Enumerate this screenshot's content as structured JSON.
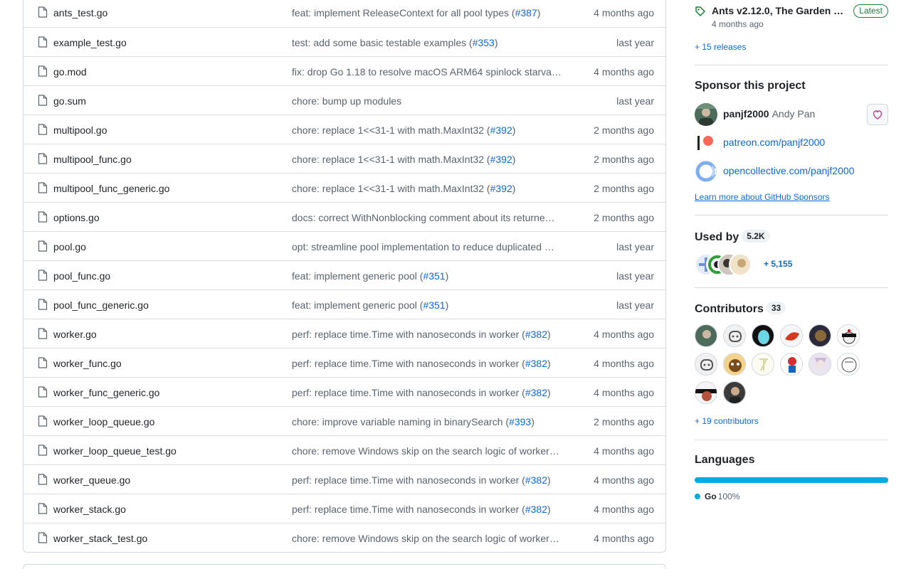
{
  "files": [
    {
      "name": "ants_test.go",
      "msg": "feat: implement ReleaseContext for all pool types (",
      "pr": "#387",
      "tail": ")",
      "age": "4 months ago"
    },
    {
      "name": "example_test.go",
      "msg": "test: add some basic testable examples (",
      "pr": "#353",
      "tail": ")",
      "age": "last year"
    },
    {
      "name": "go.mod",
      "msg": "fix: drop Go 1.18 to resolve macOS ARM64 spinlock starva…",
      "pr": "",
      "tail": "",
      "age": "4 months ago"
    },
    {
      "name": "go.sum",
      "msg": "chore: bump up modules",
      "pr": "",
      "tail": "",
      "age": "last year"
    },
    {
      "name": "multipool.go",
      "msg": "chore: replace 1<<31-1 with math.MaxInt32 (",
      "pr": "#392",
      "tail": ")",
      "age": "2 months ago"
    },
    {
      "name": "multipool_func.go",
      "msg": "chore: replace 1<<31-1 with math.MaxInt32 (",
      "pr": "#392",
      "tail": ")",
      "age": "2 months ago"
    },
    {
      "name": "multipool_func_generic.go",
      "msg": "chore: replace 1<<31-1 with math.MaxInt32 (",
      "pr": "#392",
      "tail": ")",
      "age": "2 months ago"
    },
    {
      "name": "options.go",
      "msg": "docs: correct WithNonblocking comment about its returne…",
      "pr": "",
      "tail": "",
      "age": "2 months ago"
    },
    {
      "name": "pool.go",
      "msg": "opt: streamline pool implementation to reduce duplicated …",
      "pr": "",
      "tail": "",
      "age": "last year"
    },
    {
      "name": "pool_func.go",
      "msg": "feat: implement generic pool (",
      "pr": "#351",
      "tail": ")",
      "age": "last year"
    },
    {
      "name": "pool_func_generic.go",
      "msg": "feat: implement generic pool (",
      "pr": "#351",
      "tail": ")",
      "age": "last year"
    },
    {
      "name": "worker.go",
      "msg": "perf: replace time.Time with nanoseconds in worker (",
      "pr": "#382",
      "tail": ")",
      "age": "4 months ago"
    },
    {
      "name": "worker_func.go",
      "msg": "perf: replace time.Time with nanoseconds in worker (",
      "pr": "#382",
      "tail": ")",
      "age": "4 months ago"
    },
    {
      "name": "worker_func_generic.go",
      "msg": "perf: replace time.Time with nanoseconds in worker (",
      "pr": "#382",
      "tail": ")",
      "age": "4 months ago"
    },
    {
      "name": "worker_loop_queue.go",
      "msg": "chore: improve variable naming in binarySearch (",
      "pr": "#393",
      "tail": ")",
      "age": "2 months ago"
    },
    {
      "name": "worker_loop_queue_test.go",
      "msg": "chore: remove Windows skip on the search logic of worker…",
      "pr": "",
      "tail": "",
      "age": "4 months ago"
    },
    {
      "name": "worker_queue.go",
      "msg": "perf: replace time.Time with nanoseconds in worker (",
      "pr": "#382",
      "tail": ")",
      "age": "4 months ago"
    },
    {
      "name": "worker_stack.go",
      "msg": "perf: replace time.Time with nanoseconds in worker (",
      "pr": "#382",
      "tail": ")",
      "age": "4 months ago"
    },
    {
      "name": "worker_stack_test.go",
      "msg": "chore: remove Windows skip on the search logic of worker…",
      "pr": "",
      "tail": "",
      "age": "4 months ago"
    }
  ],
  "sidebar": {
    "release": {
      "title": "Ants v2.12.0, The Garden …",
      "badge": "Latest",
      "date": "4 months ago",
      "more": "+ 15 releases"
    },
    "sponsor": {
      "heading": "Sponsor this project",
      "user_login": "panjf2000",
      "user_name": "Andy Pan",
      "patreon": "patreon.com/panjf2000",
      "opencollective": "opencollective.com/panjf2000",
      "learn_more": "Learn more about GitHub Sponsors"
    },
    "used_by": {
      "heading": "Used by",
      "count": "5.2K",
      "more": "+ 5,155"
    },
    "contributors": {
      "heading": "Contributors",
      "count": "33",
      "more": "+ 19 contributors"
    },
    "languages": {
      "heading": "Languages",
      "items": [
        {
          "name": "Go",
          "percent": "100%",
          "color": "#00add8"
        }
      ]
    }
  },
  "colors": {
    "link": "#0969da",
    "muted": "#59636e",
    "border": "#d0d7de",
    "latest_green": "#1a7f37",
    "go_blue": "#00add8",
    "heart_pink": "#bf3989"
  }
}
